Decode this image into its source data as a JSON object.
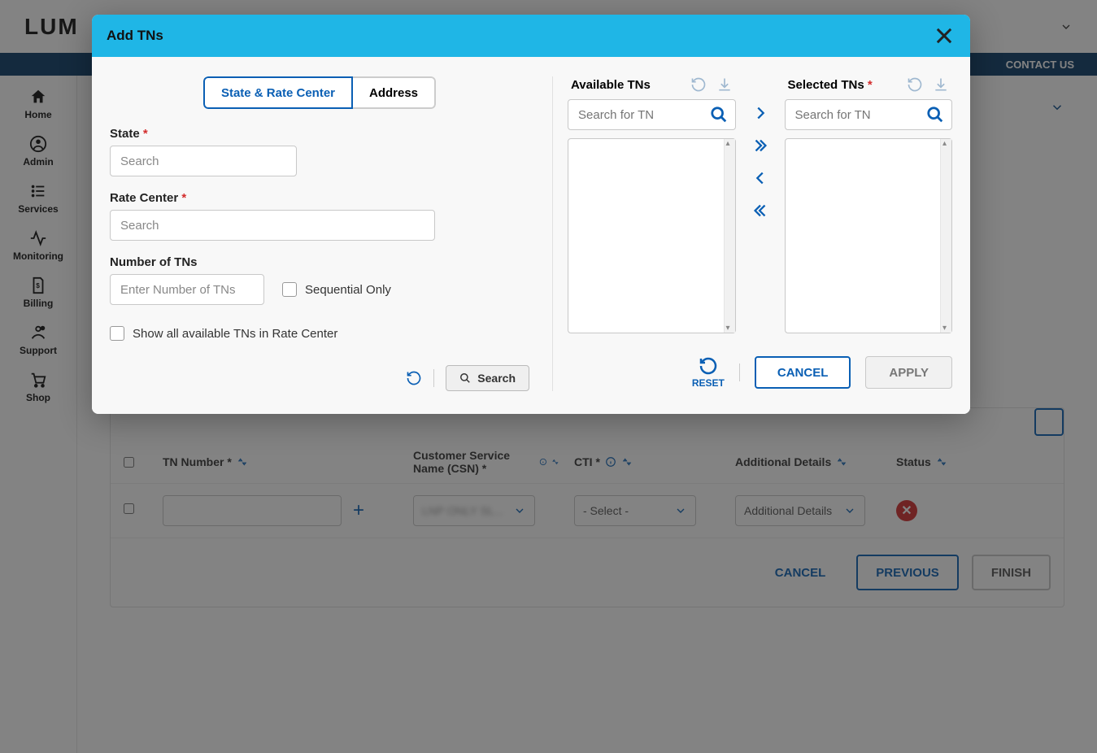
{
  "topbar": {
    "logo": "LUM",
    "contact": "CONTACT US"
  },
  "sidebar": {
    "items": [
      {
        "label": "Home"
      },
      {
        "label": "Admin"
      },
      {
        "label": "Services"
      },
      {
        "label": "Monitoring"
      },
      {
        "label": "Billing"
      },
      {
        "label": "Support"
      },
      {
        "label": "Shop"
      }
    ]
  },
  "table": {
    "headers": {
      "tn": "TN Number *",
      "csn": "Customer Service Name (CSN) *",
      "cti": "CTI *",
      "details": "Additional Details",
      "status": "Status"
    },
    "row": {
      "csn_value": "",
      "cti_placeholder": "- Select -",
      "details_label": "Additional Details"
    },
    "footer": {
      "cancel": "CANCEL",
      "previous": "PREVIOUS",
      "finish": "FINISH"
    }
  },
  "modal": {
    "title": "Add TNs",
    "tabs": {
      "state": "State & Rate Center",
      "address": "Address"
    },
    "fields": {
      "state_label": "State",
      "state_placeholder": "Search",
      "rate_label": "Rate Center",
      "rate_placeholder": "Search",
      "num_label": "Number of TNs",
      "num_placeholder": "Enter Number of TNs",
      "sequential": "Sequential Only",
      "show_all": "Show all available TNs in Rate Center",
      "search_btn": "Search"
    },
    "lists": {
      "available": "Available TNs",
      "selected": "Selected TNs",
      "search_placeholder": "Search for TN"
    },
    "footer": {
      "reset": "RESET",
      "cancel": "CANCEL",
      "apply": "APPLY"
    }
  }
}
